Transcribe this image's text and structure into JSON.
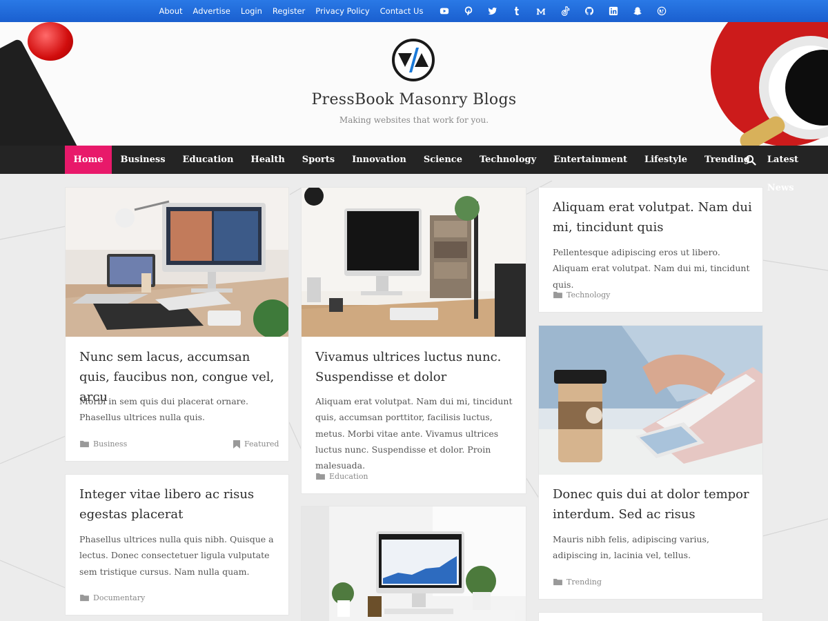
{
  "topbar": {
    "links": [
      "About",
      "Advertise",
      "Login",
      "Register",
      "Privacy Policy",
      "Contact Us"
    ],
    "social_icons": [
      "youtube-icon",
      "pinterest-icon",
      "twitter-icon",
      "tumblr-icon",
      "medium-icon",
      "tiktok-icon",
      "github-icon",
      "linkedin-icon",
      "snapchat-icon",
      "wordpress-icon"
    ]
  },
  "site": {
    "title": "PressBook Masonry Blogs",
    "tagline": "Making websites that work for you."
  },
  "nav": {
    "items": [
      "Home",
      "Business",
      "Education",
      "Health",
      "Sports",
      "Innovation",
      "Science",
      "Technology",
      "Entertainment",
      "Lifestyle",
      "Trending",
      "Latest News"
    ],
    "active": "Home"
  },
  "posts": [
    {
      "title": "Nunc sem lacus, accumsan quis, faucibus non, congue vel, arcu",
      "excerpt": "Morbi in sem quis dui placerat ornare. Phasellus ultrices nulla quis.",
      "category": "Business",
      "badge": "Featured"
    },
    {
      "title": "Vivamus ultrices luctus nunc. Suspendisse et dolor",
      "excerpt": "Aliquam erat volutpat. Nam dui mi, tincidunt quis, accumsan porttitor, facilisis luctus, metus. Morbi vitae ante. Vivamus ultrices luctus nunc. Suspendisse et dolor. Proin malesuada.",
      "category": "Education"
    },
    {
      "title": "Aliquam erat volutpat. Nam dui mi, tincidunt quis",
      "excerpt": "Pellentesque adipiscing eros ut libero. Aliquam erat volutpat. Nam dui mi, tincidunt quis.",
      "category": "Technology"
    },
    {
      "title": "Integer vitae libero ac risus egestas placerat",
      "excerpt": "Phasellus ultrices nulla quis nibh. Quisque a lectus. Donec consectetuer ligula vulputate sem tristique cursus. Nam nulla quam.",
      "category": "Documentary"
    },
    {
      "title": "Donec quis dui at dolor tempor interdum. Sed ac risus",
      "excerpt": "Mauris nibh felis, adipiscing varius, adipiscing in, lacinia vel, tellus.",
      "category": "Trending"
    }
  ],
  "colors": {
    "topbar": "#1f6ad8",
    "nav_bg": "#242424",
    "accent": "#e8196a"
  }
}
